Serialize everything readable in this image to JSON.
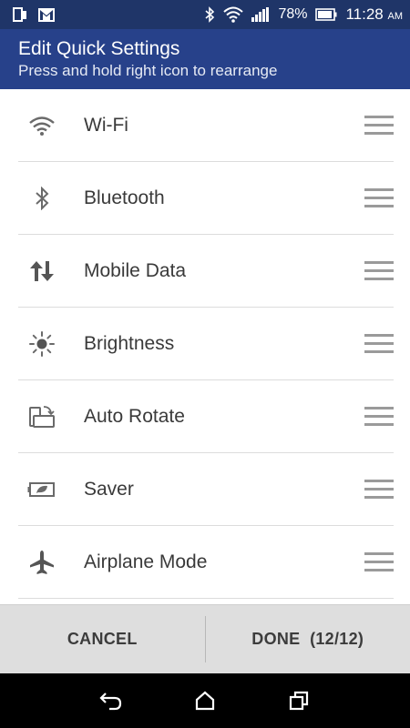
{
  "status_bar": {
    "battery": "78%",
    "time": "11:28",
    "ampm": "AM",
    "icons": [
      "screen-mirror-icon",
      "gmail-icon",
      "bluetooth-icon",
      "wifi-icon",
      "signal-icon",
      "battery-icon"
    ]
  },
  "header": {
    "title": "Edit Quick Settings",
    "subtitle": "Press and hold right icon to rearrange"
  },
  "colors": {
    "status_bar": "#1f3568",
    "header": "#27418a",
    "footer": "#dedede",
    "nav_bar": "#000000"
  },
  "settings": [
    {
      "label": "Wi-Fi",
      "icon": "wifi-icon"
    },
    {
      "label": "Bluetooth",
      "icon": "bluetooth-icon"
    },
    {
      "label": "Mobile Data",
      "icon": "mobile-data-icon"
    },
    {
      "label": "Brightness",
      "icon": "brightness-icon"
    },
    {
      "label": "Auto Rotate",
      "icon": "auto-rotate-icon"
    },
    {
      "label": "Saver",
      "icon": "battery-saver-icon"
    },
    {
      "label": "Airplane Mode",
      "icon": "airplane-icon"
    }
  ],
  "footer": {
    "cancel_label": "CANCEL",
    "done_label": "DONE  (12/12)"
  },
  "nav_bar": {
    "icons": [
      "back-icon",
      "home-icon",
      "recent-apps-icon"
    ]
  }
}
